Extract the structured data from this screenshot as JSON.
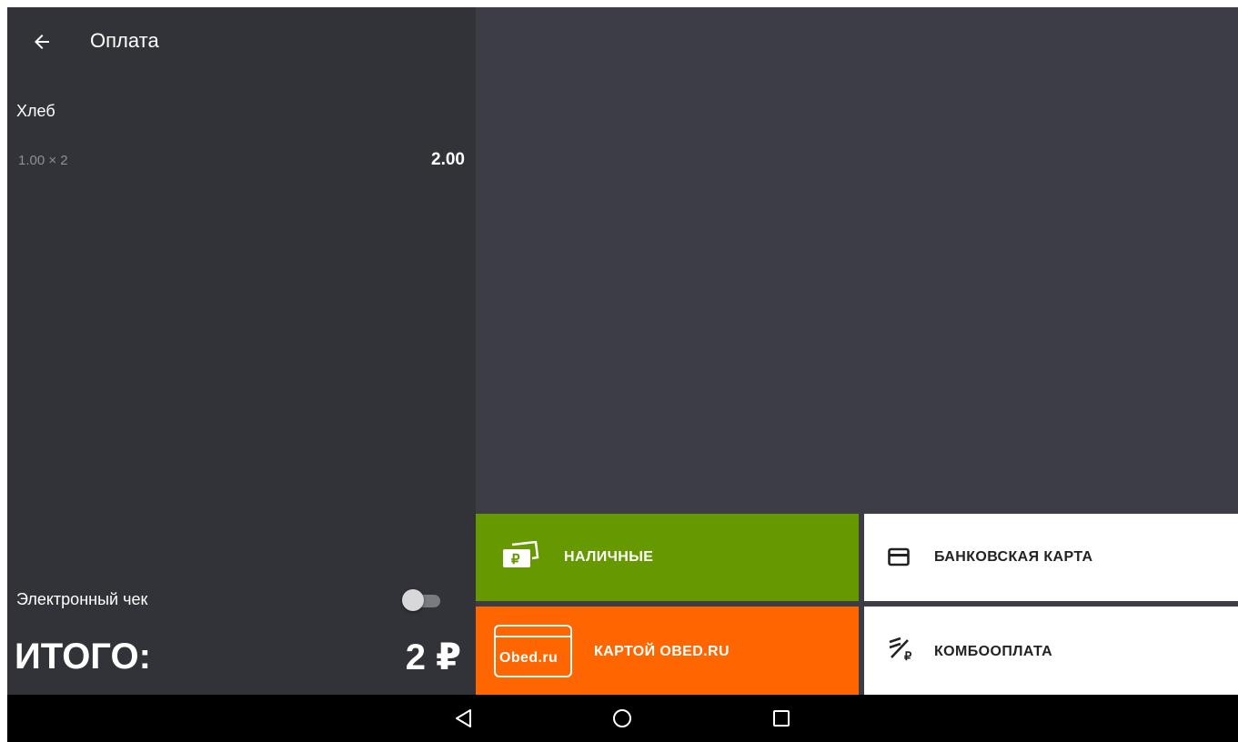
{
  "header": {
    "title": "Оплата",
    "back_icon": "arrow-left-icon"
  },
  "order": {
    "items": [
      {
        "name": "Хлеб",
        "qty_line": "1.00 × 2",
        "sum": "2.00"
      }
    ]
  },
  "echeck": {
    "label": "Электронный чек",
    "enabled": false
  },
  "total": {
    "label": "ИТОГО:",
    "value": "2 ₽"
  },
  "payments": {
    "cash": {
      "label": "НАЛИЧНЫЕ",
      "icon": "cash-icon",
      "color": "#669900"
    },
    "bank_card": {
      "label": "БАНКОВСКАЯ КАРТА",
      "icon": "credit-card-icon",
      "color": "#ffffff"
    },
    "obed_card": {
      "label": "КАРТОЙ OBED.RU",
      "icon": "obed-card-icon",
      "logo_text": "Obed.ru",
      "color": "#ff6600"
    },
    "combo": {
      "label": "КОМБООПЛАТА",
      "icon": "combo-payment-icon",
      "color": "#ffffff"
    }
  },
  "navbar": {
    "back": "triangle-back-icon",
    "home": "circle-home-icon",
    "recent": "square-recent-icon"
  },
  "colors": {
    "left_bg": "#323338",
    "right_bg": "#3c3d45",
    "secondary_text": "#8e8f95"
  }
}
